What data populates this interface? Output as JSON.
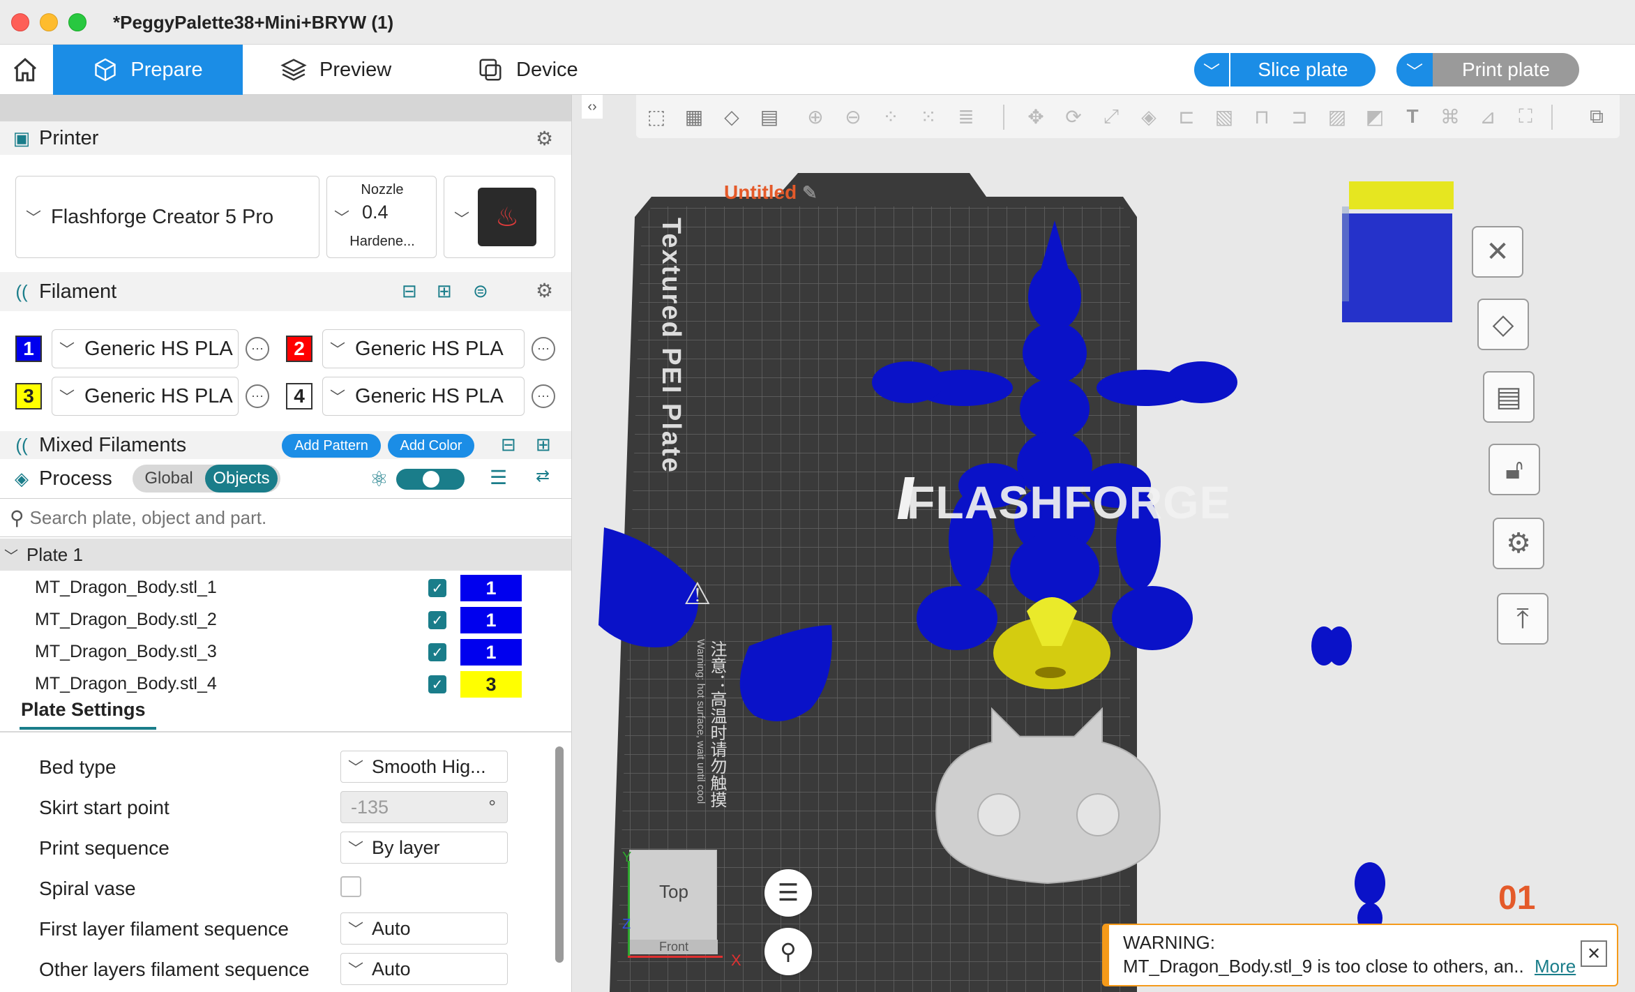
{
  "window": {
    "title": "*PeggyPalette38+Mini+BRYW (1)"
  },
  "tabs": [
    {
      "label": "Prepare",
      "icon": "cube-icon"
    },
    {
      "label": "Preview",
      "icon": "layers-icon"
    },
    {
      "label": "Device",
      "icon": "device-icon"
    }
  ],
  "actions": {
    "slice_label": "Slice plate",
    "print_label": "Print plate"
  },
  "printer": {
    "section_label": "Printer",
    "name": "Flashforge Creator 5 Pro",
    "nozzle_label": "Nozzle",
    "nozzle_value": "0.4",
    "nozzle_type": "Hardene..."
  },
  "filament": {
    "section_label": "Filament",
    "slots": [
      {
        "index": "1",
        "name": "Generic HS PLA",
        "color": "#0000ee",
        "text_color": "#ffffff"
      },
      {
        "index": "2",
        "name": "Generic HS PLA",
        "color": "#ff0000",
        "text_color": "#ffffff"
      },
      {
        "index": "3",
        "name": "Generic HS PLA",
        "color": "#ffff00",
        "text_color": "#222222"
      },
      {
        "index": "4",
        "name": "Generic HS PLA",
        "color": "#ffffff",
        "text_color": "#222222"
      }
    ]
  },
  "mixed": {
    "section_label": "Mixed Filaments",
    "add_pattern": "Add Pattern",
    "add_color": "Add Color"
  },
  "process": {
    "section_label": "Process",
    "toggle_global": "Global",
    "toggle_objects": "Objects"
  },
  "search": {
    "placeholder": "Search plate, object and part."
  },
  "plate": {
    "label": "Plate 1",
    "objects": [
      {
        "name": "MT_Dragon_Body.stl_1",
        "extruder": "1",
        "color": "#0000ee",
        "text_color": "#ffffff"
      },
      {
        "name": "MT_Dragon_Body.stl_2",
        "extruder": "1",
        "color": "#0000ee",
        "text_color": "#ffffff"
      },
      {
        "name": "MT_Dragon_Body.stl_3",
        "extruder": "1",
        "color": "#0000ee",
        "text_color": "#ffffff"
      },
      {
        "name": "MT_Dragon_Body.stl_4",
        "extruder": "3",
        "color": "#ffff00",
        "text_color": "#222222"
      }
    ]
  },
  "plate_settings": {
    "tab_label": "Plate Settings",
    "rows": [
      {
        "label": "Bed type",
        "value": "Smooth Hig..."
      },
      {
        "label": "Skirt start point",
        "value": "-135",
        "unit": "°"
      },
      {
        "label": "Print sequence",
        "value": "By layer"
      },
      {
        "label": "Spiral vase",
        "value": ""
      },
      {
        "label": "First layer filament sequence",
        "value": "Auto"
      },
      {
        "label": "Other layers filament sequence",
        "value": "Auto"
      }
    ]
  },
  "viewport": {
    "plate_name": "Untitled",
    "bed_label": "Textured PEI Plate",
    "brand_logo": "FLASHFORGE",
    "warning_cn": "注意：高温时请勿触摸",
    "warning_en": "Warning: hot surface, wait until cool",
    "plate_number": "01",
    "view_top": "Top",
    "view_front": "Front",
    "axis_x": "X",
    "axis_y": "Y",
    "axis_z": "Z"
  },
  "warning": {
    "title": "WARNING:",
    "message": "MT_Dragon_Body.stl_9 is too close to others, an..",
    "link": "More"
  }
}
